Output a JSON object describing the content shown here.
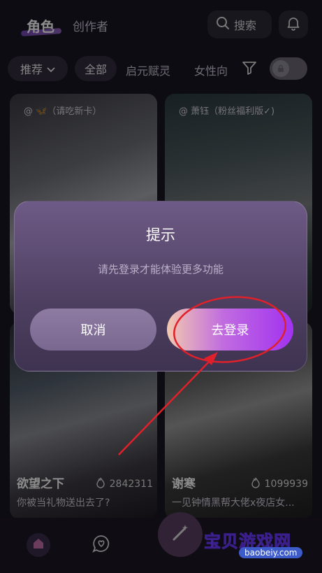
{
  "header": {
    "tab_main": "角色",
    "tab_creator": "创作者",
    "search_label": "搜索"
  },
  "filters": {
    "recommend_label": "推荐",
    "all_label": "全部",
    "tag1": "启元赋灵",
    "tag2": "女性向"
  },
  "cards": [
    {
      "author": "@ 🦋（请吃新卡）"
    },
    {
      "author": "@ 萧钰（粉丝福利版✓)"
    },
    {
      "name": "欲望之下",
      "count": "2842311",
      "desc": "你被当礼物送出去了?"
    },
    {
      "name": "谢寒",
      "count": "1099939",
      "desc": "一见钟情黑帮大佬x夜店女..."
    }
  ],
  "dialog": {
    "title": "提示",
    "message": "请先登录才能体验更多功能",
    "cancel_label": "取消",
    "login_label": "去登录"
  },
  "watermark": {
    "text": "宝贝游戏网",
    "url": "baobeiy.com"
  },
  "colors": {
    "accent": "#a232f0",
    "background": "#1b1624",
    "annotation": "#e0202a"
  }
}
